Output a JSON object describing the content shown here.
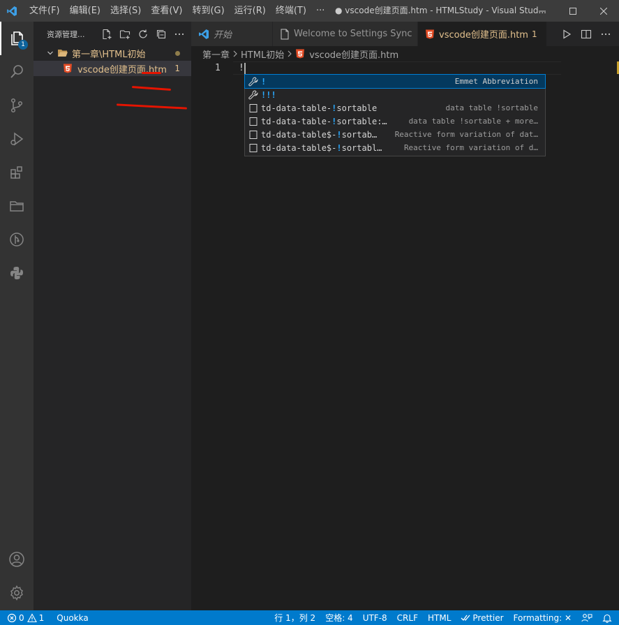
{
  "titlebar": {
    "menu": [
      "文件(F)",
      "编辑(E)",
      "选择(S)",
      "查看(V)",
      "转到(G)",
      "运行(R)",
      "终端(T)",
      "···"
    ],
    "title": "● vscode创建页面.htm - HTMLStudy - Visual Stud..."
  },
  "activitybar": {
    "explorer_badge": "1",
    "icons": [
      "files-icon",
      "search-icon",
      "source-control-icon",
      "run-debug-icon",
      "extensions-icon",
      "remote-explorer-icon",
      "git-graph-icon",
      "python-icon",
      "account-icon",
      "settings-gear-icon"
    ]
  },
  "sidebar": {
    "title": "资源管理...",
    "folder": {
      "name": "第一章\\HTML初始"
    },
    "file": {
      "name": "vscode创建页面.htm",
      "problems": "1"
    }
  },
  "tabs": [
    {
      "label": "开始",
      "italic": true
    },
    {
      "label": "Welcome to Settings Sync"
    },
    {
      "label": "vscode创建页面.htm",
      "problems": "1",
      "active": true
    }
  ],
  "breadcrumb": {
    "folder": "第一章",
    "subfolder": "HTML初始",
    "file": "vscode创建页面.htm"
  },
  "editor": {
    "line_number": "1",
    "text": "!"
  },
  "suggest": {
    "items": [
      {
        "prefix": "",
        "match": "!",
        "suffix": "",
        "detail": "Emmet Abbreviation",
        "icon": "wrench-icon"
      },
      {
        "prefix": "",
        "match": "!",
        "suffix": "!!",
        "detail": "",
        "icon": "wrench-icon"
      },
      {
        "prefix": "td-data-table-",
        "match": "!",
        "suffix": "sortable",
        "detail": "data table !sortable",
        "icon": "snippet-icon"
      },
      {
        "prefix": "td-data-table-",
        "match": "!",
        "suffix": "sortable:…",
        "detail": "data table !sortable + more…",
        "icon": "snippet-icon"
      },
      {
        "prefix": "td-data-table$-",
        "match": "!",
        "suffix": "sortab…",
        "detail": "Reactive form variation of dat…",
        "icon": "snippet-icon"
      },
      {
        "prefix": "td-data-table$-",
        "match": "!",
        "suffix": "sortabl…",
        "detail": "Reactive form variation of d…",
        "icon": "snippet-icon"
      }
    ]
  },
  "statusbar": {
    "errors": "0",
    "warnings": "1",
    "quokka": "Quokka",
    "position": "行 1，列 2",
    "indent": "空格: 4",
    "encoding": "UTF-8",
    "eol": "CRLF",
    "language": "HTML",
    "prettier": "Prettier",
    "formatting": "Formatting: ✕"
  },
  "colors": {
    "accent": "#007acc",
    "modified": "#e2c08d",
    "html5": "#e44d26",
    "annotation_red": "#e51400"
  }
}
